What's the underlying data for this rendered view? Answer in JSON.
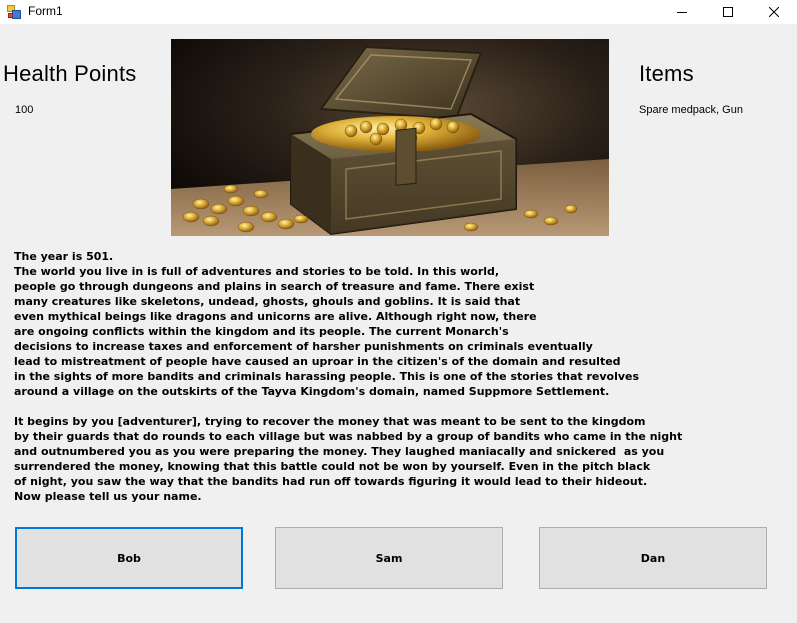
{
  "window": {
    "title": "Form1"
  },
  "health": {
    "heading": "Health Points",
    "value": "100"
  },
  "items": {
    "heading": "Items",
    "value": "Spare medpack, Gun"
  },
  "story": {
    "text": "The year is 501.\nThe world you live in is full of adventures and stories to be told. In this world,\npeople go through dungeons and plains in search of treasure and fame. There exist\nmany creatures like skeletons, undead, ghosts, ghouls and goblins. It is said that\neven mythical beings like dragons and unicorns are alive. Although right now, there\nare ongoing conflicts within the kingdom and its people. The current Monarch's\ndecisions to increase taxes and enforcement of harsher punishments on criminals eventually\nlead to mistreatment of people have caused an uproar in the citizen's of the domain and resulted\nin the sights of more bandits and criminals harassing people. This is one of the stories that revolves\naround a village on the outskirts of the Tayva Kingdom's domain, named Suppmore Settlement.\n\nIt begins by you [adventurer], trying to recover the money that was meant to be sent to the kingdom\nby their guards that do rounds to each village but was nabbed by a group of bandits who came in the night\nand outnumbered you as you were preparing the money. They laughed maniacally and snickered  as you\nsurrendered the money, knowing that this battle could not be won by yourself. Even in the pitch black\nof night, you saw the way that the bandits had run off towards figuring it would lead to their hideout.\nNow please tell us your name."
  },
  "choices": [
    {
      "label": "Bob"
    },
    {
      "label": "Sam"
    },
    {
      "label": "Dan"
    }
  ],
  "colors": {
    "background": "#f0f0f0",
    "focus_border": "#0078d7",
    "button_face": "#e1e1e1"
  },
  "icons": {
    "app": "winforms-app-icon",
    "minimize": "minimize-icon",
    "maximize": "maximize-icon",
    "close": "close-icon",
    "picture": "treasure-chest-image"
  }
}
